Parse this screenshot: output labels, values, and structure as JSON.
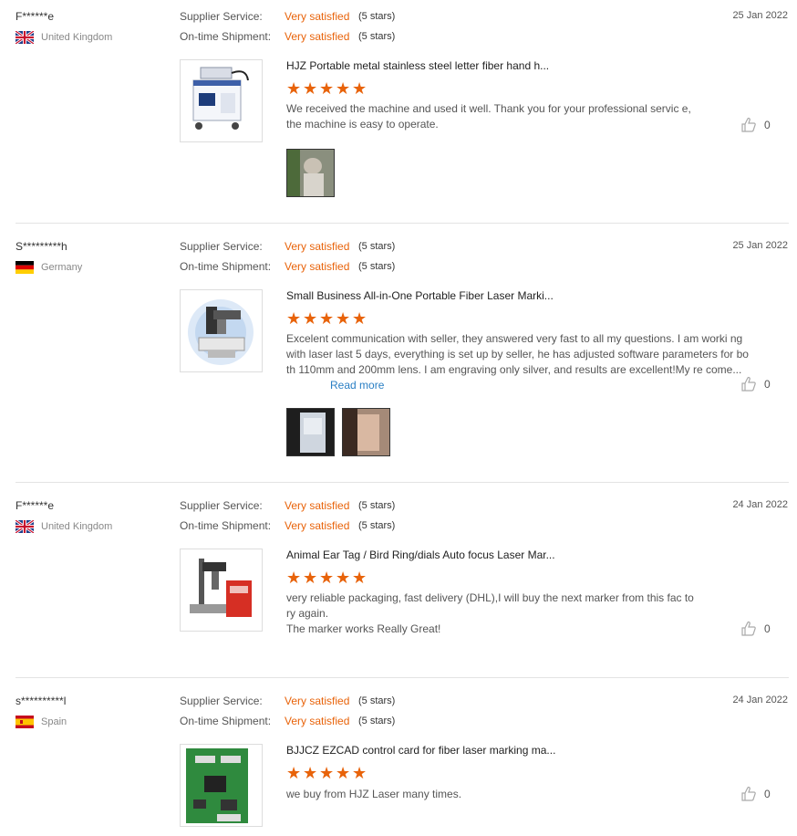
{
  "labels": {
    "supplier_service": "Supplier Service:",
    "ontime_shipment": "On-time Shipment:",
    "read_more": "Read more"
  },
  "colors": {
    "accent": "#e8630a",
    "link": "#2a7fc4"
  },
  "reviews": [
    {
      "user": "F******e",
      "country": "United Kingdom",
      "flag_icon": "uk-flag-icon",
      "date": "25 Jan 2022",
      "supplier_service": "Very satisfied",
      "supplier_stars": "(5 stars)",
      "ontime_shipment": "Very satisfied",
      "ontime_stars": "(5 stars)",
      "product_title": "HJZ Portable metal stainless steel letter fiber hand h...",
      "product_rating": 5,
      "body": "We received the machine and used it well. Thank you for your professional servic e, the machine is easy to operate.",
      "likes": "0"
    },
    {
      "user": "S*********h",
      "country": "Germany",
      "flag_icon": "germany-flag-icon",
      "date": "25 Jan 2022",
      "supplier_service": "Very satisfied",
      "supplier_stars": "(5 stars)",
      "ontime_shipment": "Very satisfied",
      "ontime_stars": "(5 stars)",
      "product_title": "Small Business All-in-One Portable Fiber Laser Marki...",
      "product_rating": 5,
      "body": "Excelent communication with seller, they answered very fast to all my questions. I am worki ng with laser last 5 days, everything is set up by seller, he has adjusted software parameters for both 110mm and 200mm lens. I am engraving only silver, and results are excellent!My re come...",
      "likes": "0"
    },
    {
      "user": "F******e",
      "country": "United Kingdom",
      "flag_icon": "uk-flag-icon",
      "date": "24 Jan 2022",
      "supplier_service": "Very satisfied",
      "supplier_stars": "(5 stars)",
      "ontime_shipment": "Very satisfied",
      "ontime_stars": "(5 stars)",
      "product_title": "Animal Ear Tag / Bird Ring/dials Auto focus Laser Mar...",
      "product_rating": 5,
      "body": "very reliable packaging, fast delivery (DHL),I will buy the next marker from this fac tory again.",
      "body2": "The marker works Really Great!",
      "likes": "0"
    },
    {
      "user": "s**********l",
      "country": "Spain",
      "flag_icon": "spain-flag-icon",
      "date": "24 Jan 2022",
      "supplier_service": "Very satisfied",
      "supplier_stars": "(5 stars)",
      "ontime_shipment": "Very satisfied",
      "ontime_stars": "(5 stars)",
      "product_title": "BJJCZ EZCAD control card for fiber laser marking ma...",
      "product_rating": 5,
      "body": "we buy from HJZ Laser many times.",
      "likes": "0"
    }
  ]
}
